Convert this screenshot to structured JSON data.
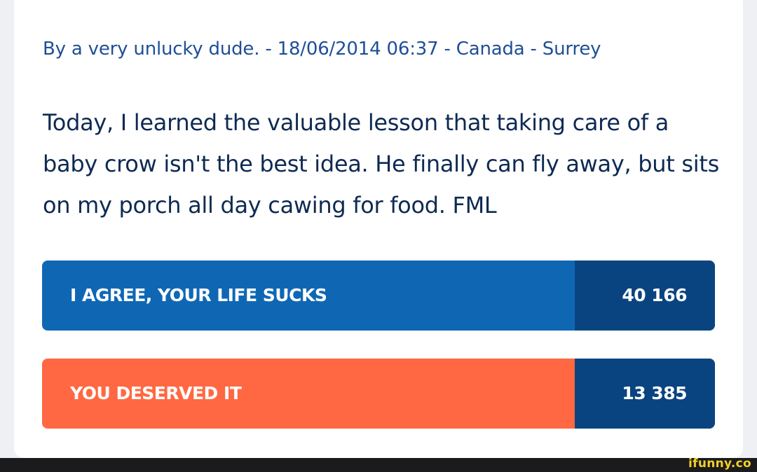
{
  "post": {
    "meta": "By a very unlucky dude. - 18/06/2014 06:37 - Canada - Surrey",
    "text": "Today, I learned the valuable lesson that taking care of a baby crow isn't the best idea. He finally can fly away, but sits on my porch all day cawing for food. FML"
  },
  "votes": {
    "agree": {
      "label": "I AGREE, YOUR LIFE SUCKS",
      "count": "40 166",
      "color": "#0f67b4"
    },
    "deserved": {
      "label": "YOU DESERVED IT",
      "count": "13 385",
      "color": "#ff6842"
    },
    "count_box_color": "#0a4480"
  },
  "watermark": "ifunny.co"
}
